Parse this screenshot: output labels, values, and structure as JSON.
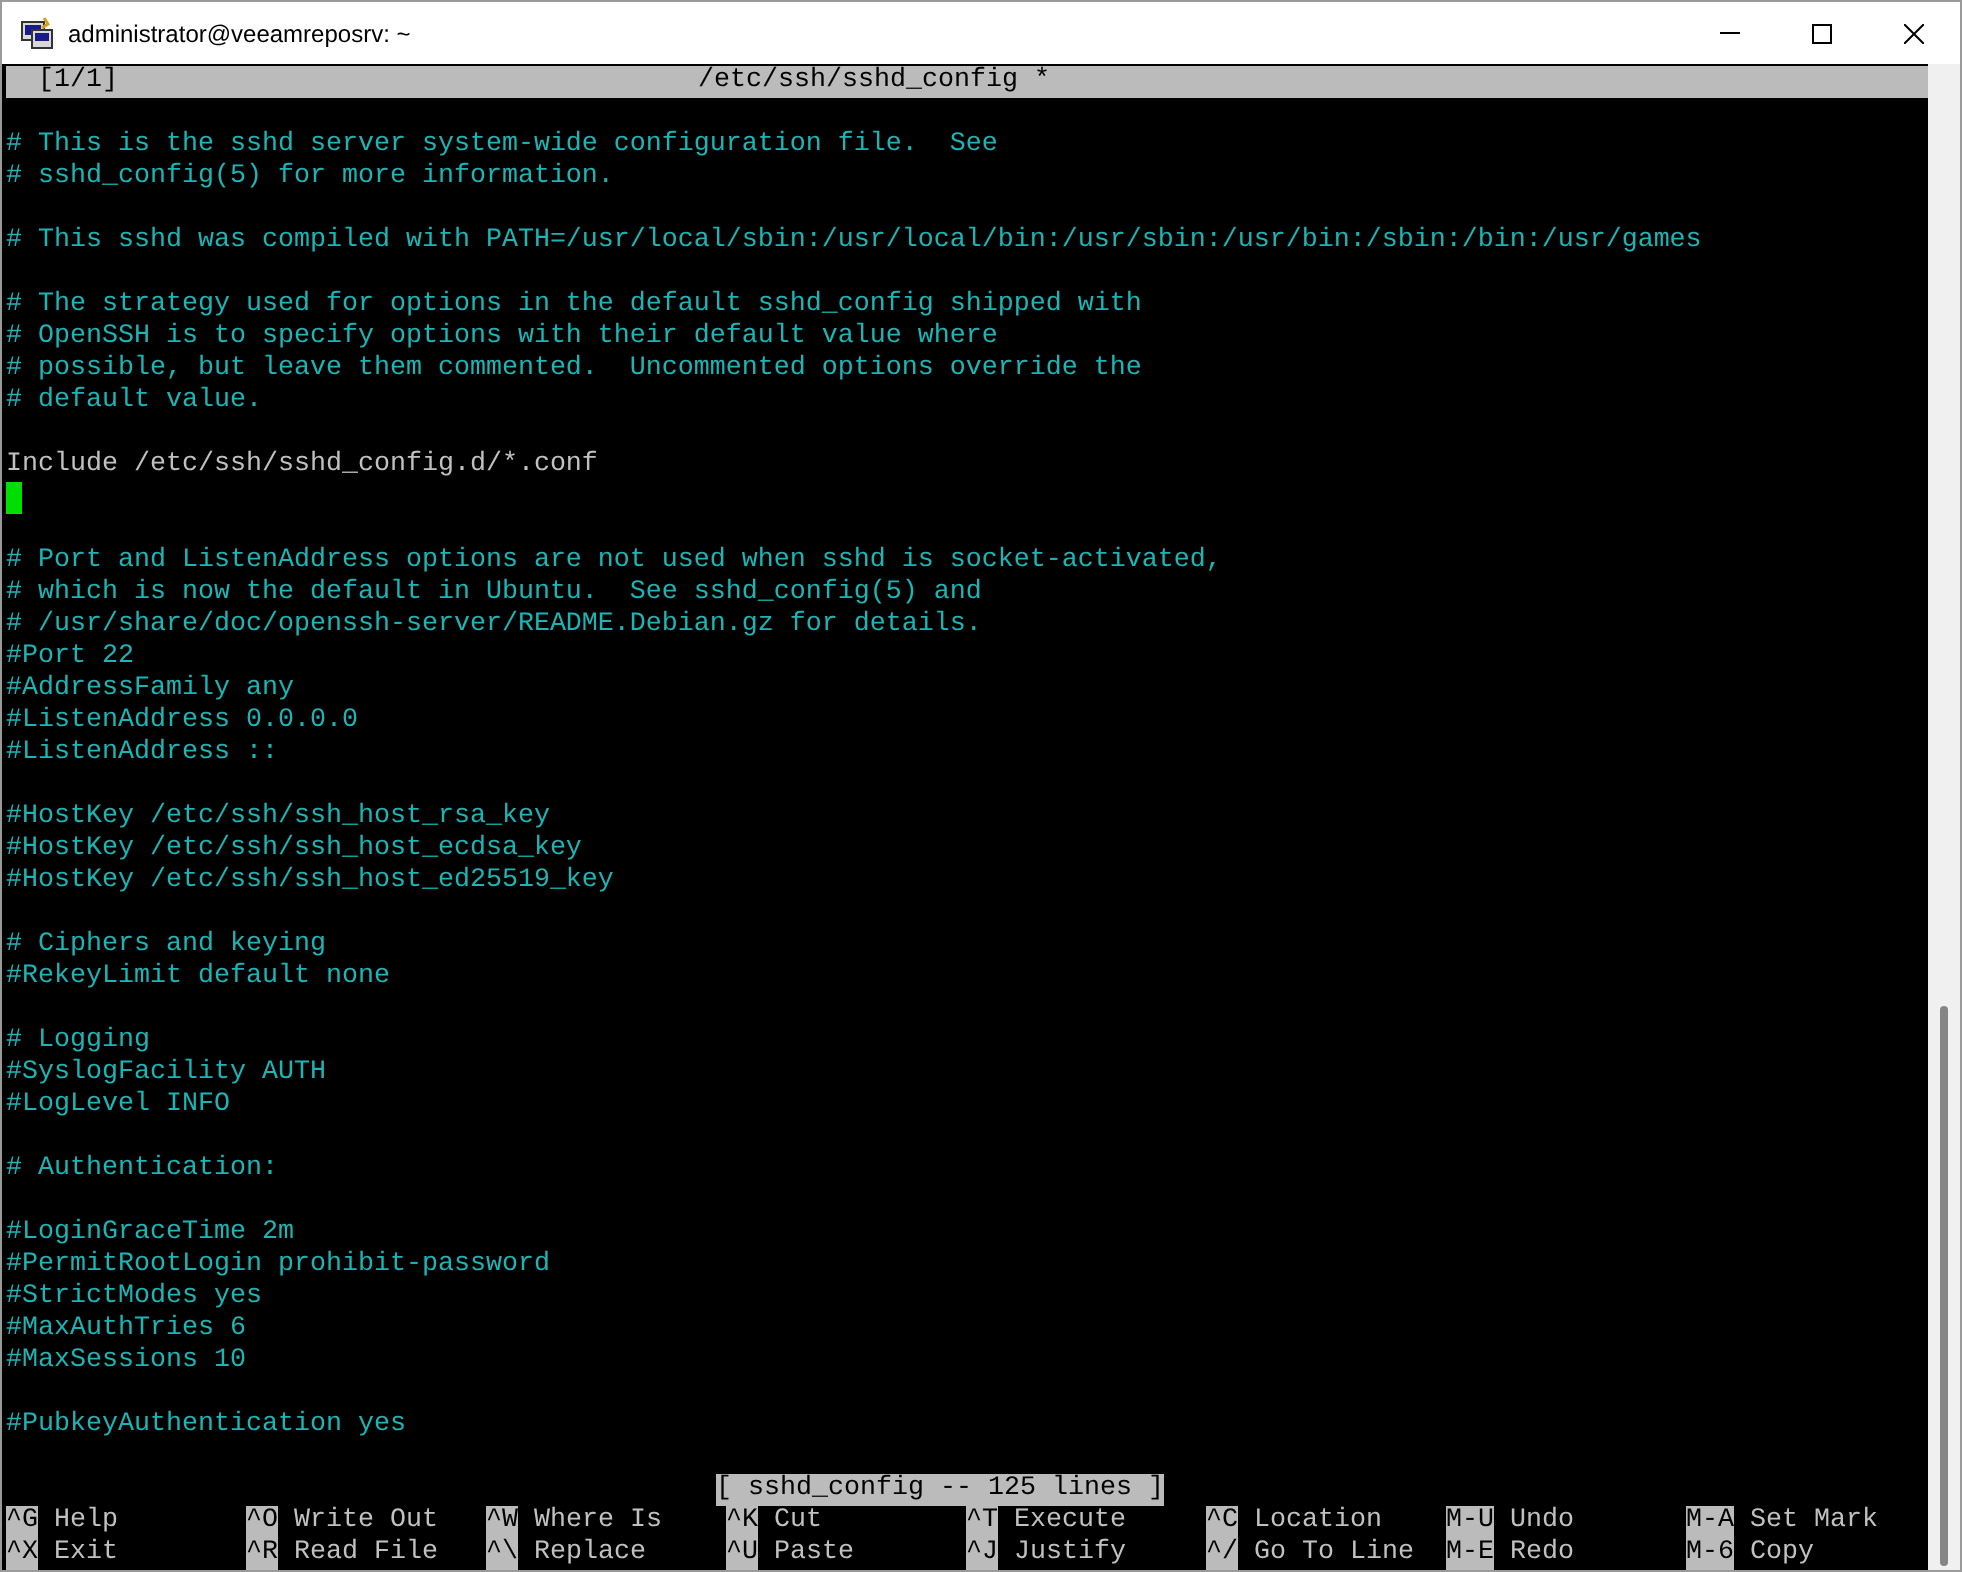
{
  "window": {
    "title": "administrator@veeamreposrv: ~"
  },
  "editor": {
    "header_left": "[1/1]",
    "filename": "/etc/ssh/sshd_config *",
    "lines": [
      {
        "kind": "blank"
      },
      {
        "kind": "comment",
        "text": "# This is the sshd server system-wide configuration file.  See"
      },
      {
        "kind": "comment",
        "text": "# sshd_config(5) for more information."
      },
      {
        "kind": "blank"
      },
      {
        "kind": "comment",
        "text": "# This sshd was compiled with PATH=/usr/local/sbin:/usr/local/bin:/usr/sbin:/usr/bin:/sbin:/bin:/usr/games"
      },
      {
        "kind": "blank"
      },
      {
        "kind": "comment",
        "text": "# The strategy used for options in the default sshd_config shipped with"
      },
      {
        "kind": "comment",
        "text": "# OpenSSH is to specify options with their default value where"
      },
      {
        "kind": "comment",
        "text": "# possible, but leave them commented.  Uncommented options override the"
      },
      {
        "kind": "comment",
        "text": "# default value."
      },
      {
        "kind": "blank"
      },
      {
        "kind": "directive",
        "text": "Include /etc/ssh/sshd_config.d/*.conf"
      },
      {
        "kind": "cursor"
      },
      {
        "kind": "blank"
      },
      {
        "kind": "comment",
        "text": "# Port and ListenAddress options are not used when sshd is socket-activated,"
      },
      {
        "kind": "comment",
        "text": "# which is now the default in Ubuntu.  See sshd_config(5) and"
      },
      {
        "kind": "comment",
        "text": "# /usr/share/doc/openssh-server/README.Debian.gz for details."
      },
      {
        "kind": "comment",
        "text": "#Port 22"
      },
      {
        "kind": "comment",
        "text": "#AddressFamily any"
      },
      {
        "kind": "comment",
        "text": "#ListenAddress 0.0.0.0"
      },
      {
        "kind": "comment",
        "text": "#ListenAddress ::"
      },
      {
        "kind": "blank"
      },
      {
        "kind": "comment",
        "text": "#HostKey /etc/ssh/ssh_host_rsa_key"
      },
      {
        "kind": "comment",
        "text": "#HostKey /etc/ssh/ssh_host_ecdsa_key"
      },
      {
        "kind": "comment",
        "text": "#HostKey /etc/ssh/ssh_host_ed25519_key"
      },
      {
        "kind": "blank"
      },
      {
        "kind": "comment",
        "text": "# Ciphers and keying"
      },
      {
        "kind": "comment",
        "text": "#RekeyLimit default none"
      },
      {
        "kind": "blank"
      },
      {
        "kind": "comment",
        "text": "# Logging"
      },
      {
        "kind": "comment",
        "text": "#SyslogFacility AUTH"
      },
      {
        "kind": "comment",
        "text": "#LogLevel INFO"
      },
      {
        "kind": "blank"
      },
      {
        "kind": "comment",
        "text": "# Authentication:"
      },
      {
        "kind": "blank"
      },
      {
        "kind": "comment",
        "text": "#LoginGraceTime 2m"
      },
      {
        "kind": "comment",
        "text": "#PermitRootLogin prohibit-password"
      },
      {
        "kind": "comment",
        "text": "#StrictModes yes"
      },
      {
        "kind": "comment",
        "text": "#MaxAuthTries 6"
      },
      {
        "kind": "comment",
        "text": "#MaxSessions 10"
      },
      {
        "kind": "blank"
      },
      {
        "kind": "comment",
        "text": "#PubkeyAuthentication yes"
      },
      {
        "kind": "blank"
      }
    ],
    "status": "[ sshd_config -- 125 lines ]",
    "shortcuts": [
      {
        "key": "^G",
        "label": "Help"
      },
      {
        "key": "^O",
        "label": "Write Out"
      },
      {
        "key": "^W",
        "label": "Where Is"
      },
      {
        "key": "^K",
        "label": "Cut"
      },
      {
        "key": "^T",
        "label": "Execute"
      },
      {
        "key": "^C",
        "label": "Location"
      },
      {
        "key": "M-U",
        "label": "Undo"
      },
      {
        "key": "M-A",
        "label": "Set Mark"
      },
      {
        "key": "^X",
        "label": "Exit"
      },
      {
        "key": "^R",
        "label": "Read File"
      },
      {
        "key": "^\\",
        "label": "Replace"
      },
      {
        "key": "^U",
        "label": "Paste"
      },
      {
        "key": "^J",
        "label": "Justify"
      },
      {
        "key": "^/",
        "label": "Go To Line"
      },
      {
        "key": "M-E",
        "label": "Redo"
      },
      {
        "key": "M-6",
        "label": "Copy"
      }
    ]
  }
}
